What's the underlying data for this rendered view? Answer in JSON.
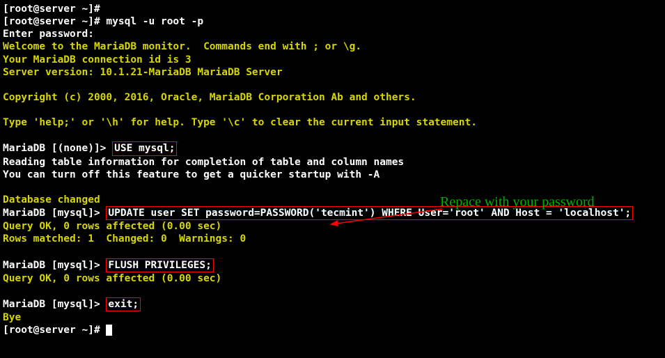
{
  "lines": {
    "l1_prompt": "[root@server ~]# ",
    "l2_prompt": "[root@server ~]# ",
    "l2_cmd": "mysql -u root -p",
    "l3": "Enter password: ",
    "welcome1": "Welcome to the MariaDB monitor.  Commands end with ; or \\g.",
    "welcome2": "Your MariaDB connection id is 3",
    "welcome3": "Server version: 10.1.21-MariaDB MariaDB Server",
    "copyright": "Copyright (c) 2000, 2016, Oracle, MariaDB Corporation Ab and others.",
    "help": "Type 'help;' or '\\h' for help. Type '\\c' to clear the current input statement.",
    "p_none": "MariaDB [(none)]> ",
    "use_cmd": "USE mysql;",
    "reading1": "Reading table information for completion of table and column names",
    "reading2": "You can turn off this feature to get a quicker startup with -A",
    "dbchanged": "Database changed",
    "p_mysql": "MariaDB [mysql]> ",
    "update_cmd": "UPDATE user SET password=PASSWORD('tecmint') WHERE User='root' AND Host = 'localhost';",
    "qok1": "Query OK, 0 rows affected (0.00 sec)",
    "rows_matched": "Rows matched: 1  Changed: 0  Warnings: 0",
    "flush_cmd": "FLUSH PRIVILEGES;",
    "qok2": "Query OK, 0 rows affected (0.00 sec)",
    "exit_cmd": "exit;",
    "bye": "Bye",
    "final_prompt": "[root@server ~]# "
  },
  "annotation": "Repace with your password",
  "colors": {
    "text_white": "#ffffff",
    "text_yellow": "#d7d700",
    "highlight_red": "#ff0000",
    "annotation_green": "#00b000",
    "background": "#000000"
  }
}
